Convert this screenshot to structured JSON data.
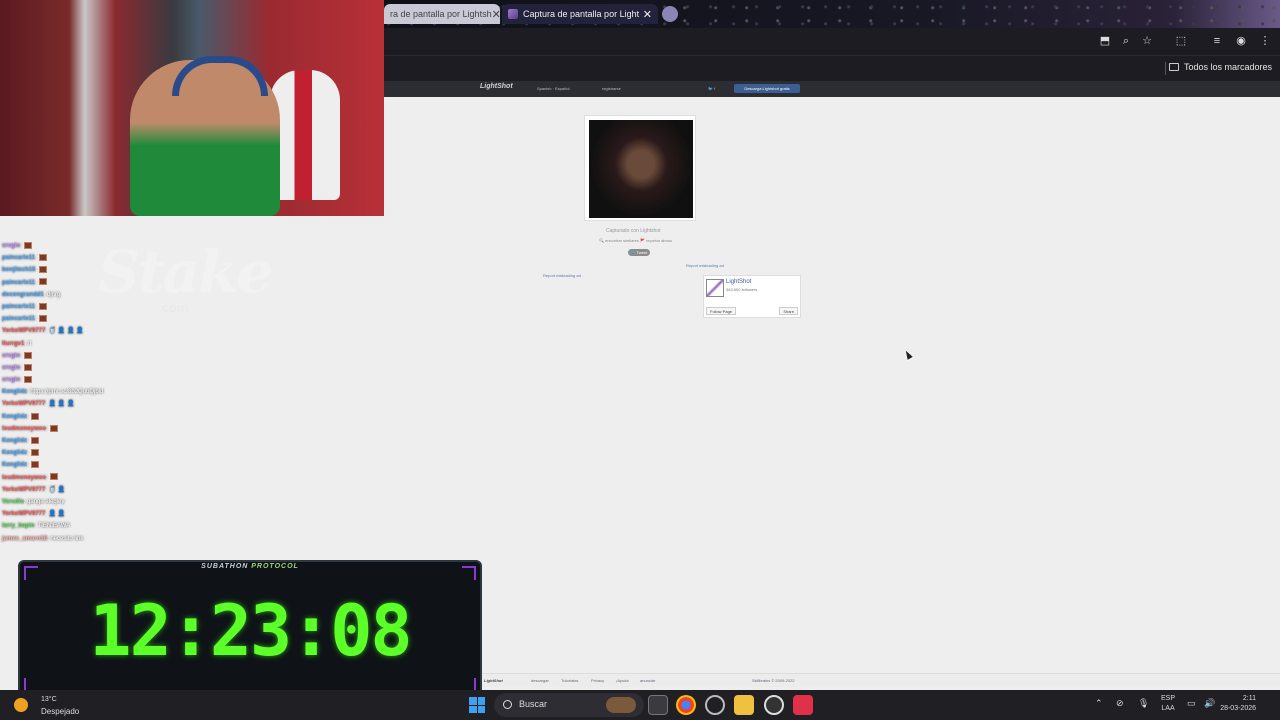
{
  "browser": {
    "tabs": [
      {
        "label": "ra de pantalla por Lightsh",
        "active": false
      },
      {
        "label": "Captura de pantalla por Light",
        "active": true
      }
    ],
    "close_glyph": "✕",
    "bookmarks_label": "Todos los marcadores"
  },
  "lightshot": {
    "logo": "LightShot",
    "language": "Spanish · Español",
    "login": "registrarse",
    "social": "🐦 f",
    "download_button": "Descarga Lightshot gratis",
    "captured_label": "Capturado con Lightshot",
    "actions": "🔍 encontrar similares   🚩 reportar abuso",
    "tweet": "🐦 Tweet",
    "report_ad_1": "Report misleading ad",
    "report_ad_2": "Report misleading ad",
    "fb": {
      "name": "LightShot",
      "count": "363,650 followers",
      "follow": "Follow Page",
      "share": "Share"
    },
    "footer": {
      "logo": "LightShot",
      "links": [
        "descargar",
        "Tutoriales",
        "Privacy",
        "¡Ayuda",
        "anunciar"
      ],
      "copyright": "Skillbrains © 2009-2022"
    }
  },
  "overlay": {
    "brand": "Stake",
    "brand_sub": ".com",
    "chat": [
      {
        "user": "srvglo",
        "color": "#c78bff",
        "msg": ":",
        "emote": true
      },
      {
        "user": "paincarlo11",
        "color": "#4aa8ff",
        "msg": ":",
        "emote": true
      },
      {
        "user": "bonjitech15",
        "color": "#4aa8ff",
        "msg": ":",
        "emote": true
      },
      {
        "user": "paincarlo11",
        "color": "#4aa8ff",
        "msg": ":",
        "emote": true
      },
      {
        "user": "docongrandd1",
        "color": "#4aa8ff",
        "msg": ": djnrg",
        "emote": false
      },
      {
        "user": "paincarlo11",
        "color": "#4aa8ff",
        "msg": ":",
        "emote": true
      },
      {
        "user": "paincarlo11",
        "color": "#4aa8ff",
        "msg": ":",
        "emote": true
      },
      {
        "user": "YerkoWPV9777",
        "color": "#ff5a5a",
        "msg": ": 🥤 👤 👤 👤",
        "emote": false
      },
      {
        "user": "Iturrgv1",
        "color": "#ff5a5a",
        "msg": ": rt",
        "emote": false
      },
      {
        "user": "srvglo",
        "color": "#c78bff",
        "msg": ":",
        "emote": true
      },
      {
        "user": "srvglo",
        "color": "#c78bff",
        "msg": ":",
        "emote": true
      },
      {
        "user": "srvglo",
        "color": "#c78bff",
        "msg": ":",
        "emote": true
      },
      {
        "user": "Kenglidz",
        "color": "#4aa8ff",
        "msg": ": https://prnt.sc/8b2QubQjbld",
        "emote": false
      },
      {
        "user": "YerkoWPV9777",
        "color": "#ff5a5a",
        "msg": ": 👤 👤 👤",
        "emote": false
      },
      {
        "user": "Kenglidz",
        "color": "#4aa8ff",
        "msg": ":",
        "emote": true
      },
      {
        "user": "loudmoneywoo",
        "color": "#ff5a5a",
        "msg": ":",
        "emote": true
      },
      {
        "user": "Kenglidz",
        "color": "#4aa8ff",
        "msg": ":",
        "emote": true
      },
      {
        "user": "Kenglidz",
        "color": "#4aa8ff",
        "msg": ":",
        "emote": true
      },
      {
        "user": "Kenglidz",
        "color": "#4aa8ff",
        "msg": ":",
        "emote": true
      },
      {
        "user": "loudmoneywoo",
        "color": "#ff5a5a",
        "msg": ":",
        "emote": true
      },
      {
        "user": "YerkoWPV9777",
        "color": "#ff5a5a",
        "msg": ": 🥤 👤",
        "emote": false
      },
      {
        "user": "Varudia",
        "color": "#5fe05f",
        "msg": ": ganga alegley",
        "emote": false
      },
      {
        "user": "YerkoWPV9777",
        "color": "#ff5a5a",
        "msg": ": 👤 👤",
        "emote": false
      },
      {
        "user": "larry_bapin",
        "color": "#5fe05f",
        "msg": ": TIENIEAWA",
        "emote": false
      },
      {
        "user": "james_amaro18",
        "color": "#ffb0b0",
        "msg": ": necesito link",
        "emote": false
      }
    ],
    "timer": {
      "title_a": "SUBATHON ",
      "title_b": "PROTOCOL",
      "time": "12:23:08"
    }
  },
  "taskbar": {
    "weather_temp": "13°C",
    "weather_desc": "Despejado",
    "search_label": "Buscar",
    "lang_line1": "ESP",
    "lang_line2": "LAA",
    "time": "2:11",
    "date": "28-03-2026"
  }
}
